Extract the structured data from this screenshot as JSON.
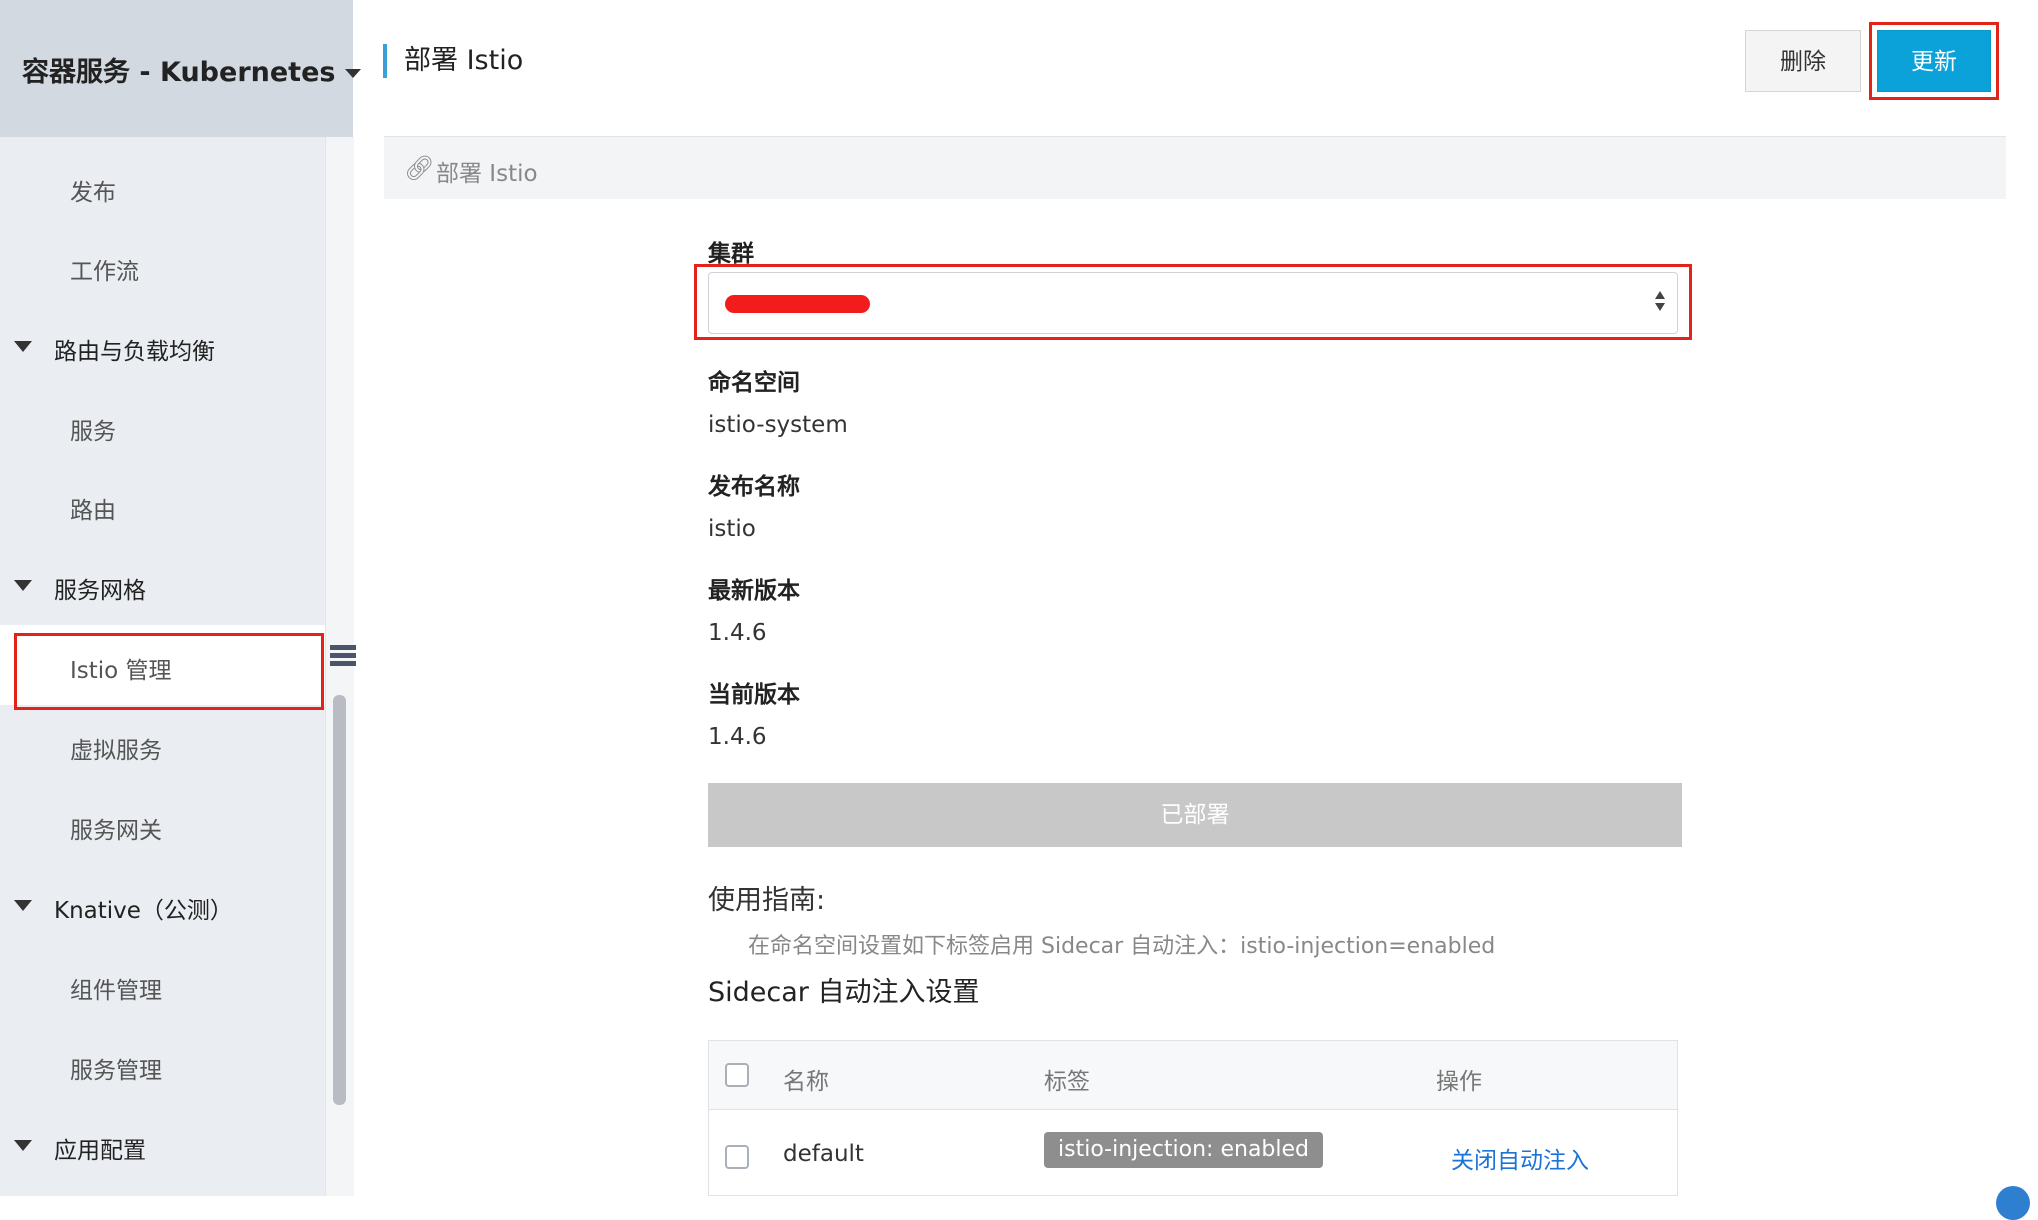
{
  "sidebar": {
    "title": "容器服务 - Kubernetes",
    "items": [
      {
        "label": "发布",
        "type": "item"
      },
      {
        "label": "工作流",
        "type": "item"
      },
      {
        "label": "路由与负载均衡",
        "type": "group"
      },
      {
        "label": "服务",
        "type": "item"
      },
      {
        "label": "路由",
        "type": "item"
      },
      {
        "label": "服务网格",
        "type": "group"
      },
      {
        "label": "Istio 管理",
        "type": "item",
        "active": true
      },
      {
        "label": "虚拟服务",
        "type": "item"
      },
      {
        "label": "服务网关",
        "type": "item"
      },
      {
        "label": "Knative（公测）",
        "type": "group"
      },
      {
        "label": "组件管理",
        "type": "item"
      },
      {
        "label": "服务管理",
        "type": "item"
      },
      {
        "label": "应用配置",
        "type": "group"
      }
    ]
  },
  "header": {
    "title": "部署 Istio",
    "delete_label": "删除",
    "update_label": "更新"
  },
  "breadcrumb": {
    "icon": "link-icon",
    "text": "部署 Istio"
  },
  "form": {
    "cluster_label": "集群",
    "cluster_value": "",
    "namespace_label": "命名空间",
    "namespace_value": "istio-system",
    "release_label": "发布名称",
    "release_value": "istio",
    "latest_label": "最新版本",
    "latest_value": "1.4.6",
    "current_label": "当前版本",
    "current_value": "1.4.6",
    "deployed_label": "已部署"
  },
  "guide": {
    "title": "使用指南:",
    "text": "在命名空间设置如下标签启用 Sidecar 自动注入：istio-injection=enabled"
  },
  "sidecar": {
    "title": "Sidecar 自动注入设置",
    "columns": [
      "名称",
      "标签",
      "操作"
    ],
    "rows": [
      {
        "name": "default",
        "label": "istio-injection: enabled",
        "action": "关闭自动注入"
      }
    ]
  },
  "colors": {
    "accent": "#0aa2d9",
    "highlight": "#e2231a",
    "link": "#1b73d6"
  }
}
